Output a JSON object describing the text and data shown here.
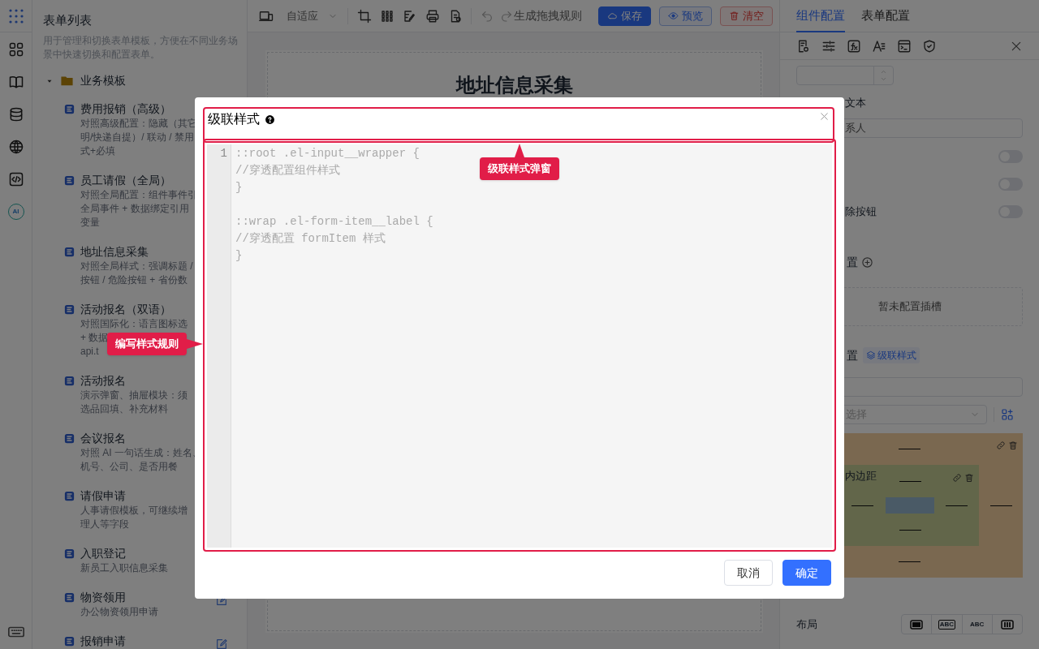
{
  "rail": {
    "ai_badge": "AI"
  },
  "sidebar": {
    "title": "表单列表",
    "description": "用于管理和切换表单模板，方便在不同业务场景中快速切换和配置表单。",
    "folder": {
      "label": "业务模板",
      "expanded": true,
      "children": [
        {
          "title": "费用报销（高级）",
          "description_lines": [
            "对照高级配置：隐藏（其它",
            "明/快递自提）/ 联动 / 禁用",
            "式+必填"
          ],
          "editable": false
        },
        {
          "title": "员工请假（全局）",
          "description_lines": [
            "对照全局配置：组件事件引",
            "全局事件 + 数据绑定引用",
            "变量"
          ],
          "editable": false
        },
        {
          "title": "地址信息采集",
          "description_lines": [
            "对照全局样式：强调标题 /",
            "按钮 / 危险按钮 + 省份数"
          ],
          "editable": false
        },
        {
          "title": "活动报名（双语）",
          "description_lines": [
            "对照国际化：语言图标选",
            "+ 数据",
            "api.t"
          ],
          "editable": false
        },
        {
          "title": "活动报名",
          "description_lines": [
            "演示弹窗、抽屉模块：须",
            "选品回填、补充材料"
          ],
          "editable": false
        },
        {
          "title": "会议报名",
          "description_lines": [
            "对照 AI 一句话生成：姓名、",
            "机号、公司、是否用餐"
          ],
          "editable": false
        },
        {
          "title": "请假申请",
          "description_lines": [
            "人事请假模板，可继续增",
            "理人等字段"
          ],
          "editable": false
        },
        {
          "title": "入职登记",
          "description_lines": [
            "新员工入职信息采集"
          ],
          "editable": false
        },
        {
          "title": "物资领用",
          "description_lines": [
            "办公物资领用申请"
          ],
          "editable": true
        },
        {
          "title": "报销申请",
          "editable": true
        }
      ]
    }
  },
  "toolbar": {
    "device_select": "自适应",
    "generate_rule": "生成拖拽规则",
    "buttons": [
      {
        "label": "保存",
        "kind": "primary"
      },
      {
        "label": "预览",
        "kind": "outline"
      },
      {
        "label": "清空",
        "kind": "danger"
      }
    ]
  },
  "canvas": {
    "form_title": "地址信息采集"
  },
  "properties": {
    "tabs": [
      {
        "label": "组件配置",
        "selected": true
      },
      {
        "label": "表单配置",
        "selected": false
      }
    ],
    "placeholder_label": "文本",
    "placeholder_value": "系人",
    "switches": [
      {
        "on": false
      },
      {
        "on": false
      },
      {
        "label": "除按钮",
        "on": false
      }
    ],
    "slot_section": {
      "label": "置",
      "empty_text": "暂未配置插槽"
    },
    "style_section": {
      "label": "置",
      "cascade_button": "级联样式"
    },
    "class_select": {
      "placeholder": "选择"
    },
    "box_model": {
      "padding_label": "内边距"
    },
    "layout": {
      "label": "布局",
      "options": [
        {
          "kind": "block"
        },
        {
          "kind": "inline-block",
          "text": "ABC"
        },
        {
          "kind": "inline",
          "text": "ABC"
        },
        {
          "kind": "flex"
        }
      ]
    }
  },
  "dialog": {
    "title": "级联样式",
    "gutter": [
      "1"
    ],
    "code": "::root .el-input__wrapper {\n//穿透配置组件样式\n}\n\n::wrap .el-form-item__label {\n//穿透配置 formItem 样式\n}",
    "buttons": [
      {
        "label": "取消",
        "kind": "default"
      },
      {
        "label": "确定",
        "kind": "primary"
      }
    ]
  },
  "annotations": [
    {
      "text": "级联样式弹窗",
      "kind": "up"
    },
    {
      "text": "编写样式规则",
      "kind": "right"
    }
  ]
}
